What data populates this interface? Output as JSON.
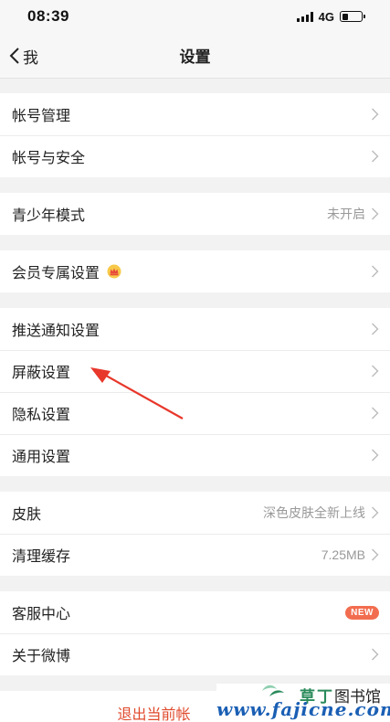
{
  "status": {
    "time": "08:39",
    "network": "4G",
    "battery_level": 0.3
  },
  "nav": {
    "back_label": "我",
    "title": "设置"
  },
  "groups": [
    {
      "items": [
        {
          "label": "帐号管理"
        },
        {
          "label": "帐号与安全"
        }
      ]
    },
    {
      "items": [
        {
          "label": "青少年模式",
          "value": "未开启"
        }
      ]
    },
    {
      "items": [
        {
          "label": "会员专属设置",
          "icon": "crown-icon"
        }
      ]
    },
    {
      "items": [
        {
          "label": "推送通知设置"
        },
        {
          "label": "屏蔽设置"
        },
        {
          "label": "隐私设置"
        },
        {
          "label": "通用设置"
        }
      ]
    },
    {
      "items": [
        {
          "label": "皮肤",
          "value": "深色皮肤全新上线"
        },
        {
          "label": "清理缓存",
          "value": "7.25MB"
        }
      ]
    },
    {
      "items": [
        {
          "label": "客服中心",
          "badge": "NEW"
        },
        {
          "label": "关于微博"
        }
      ]
    }
  ],
  "logout": {
    "label": "退出当前帐"
  },
  "watermark": {
    "brand_part1": "草",
    "brand_part2": "丁",
    "brand_part3": "图书馆",
    "url": "www.fajicne.com"
  },
  "colors": {
    "accent_red": "#e04a2c",
    "badge_bg": "#f26d4f",
    "annotation_arrow": "#e8372b",
    "watermark_blue": "#1a5fb4",
    "watermark_green": "#2a8a5a"
  }
}
